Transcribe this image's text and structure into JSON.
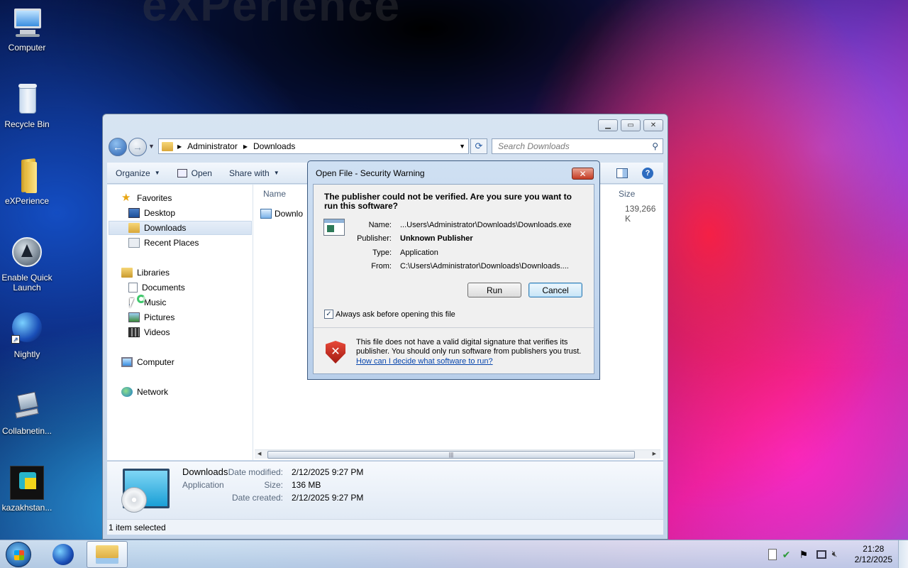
{
  "desktop": {
    "watermark": "eXPerience",
    "icons": [
      {
        "label": "Computer",
        "icon": "computer-icon"
      },
      {
        "label": "Recycle Bin",
        "icon": "recycle-bin-icon"
      },
      {
        "label": "eXPerience",
        "icon": "folder-icon"
      },
      {
        "label": "Enable Quick Launch",
        "icon": "quick-launch-icon"
      },
      {
        "label": "Nightly",
        "icon": "nightly-browser-icon"
      },
      {
        "label": "Collabnetin...",
        "icon": "network-computer-icon"
      },
      {
        "label": "kazakhstan...",
        "icon": "app-icon"
      }
    ]
  },
  "explorer": {
    "breadcrumb": [
      "Administrator",
      "Downloads"
    ],
    "search_placeholder": "Search Downloads",
    "toolbar": {
      "organize": "Organize",
      "open": "Open",
      "share_with": "Share with"
    },
    "nav": {
      "favorites": "Favorites",
      "desktop": "Desktop",
      "downloads": "Downloads",
      "recent": "Recent Places",
      "libraries": "Libraries",
      "documents": "Documents",
      "music": "Music",
      "pictures": "Pictures",
      "videos": "Videos",
      "computer": "Computer",
      "network": "Network"
    },
    "columns": {
      "name": "Name",
      "size": "Size"
    },
    "file": {
      "name": "Downlo",
      "size": "139,266 K"
    },
    "details": {
      "name": "Downloads",
      "type": "Application",
      "date_modified_label": "Date modified:",
      "date_modified": "2/12/2025 9:27 PM",
      "size_label": "Size:",
      "size": "136 MB",
      "date_created_label": "Date created:",
      "date_created": "2/12/2025 9:27 PM"
    },
    "status": "1 item selected"
  },
  "dialog": {
    "title": "Open File - Security Warning",
    "question": "The publisher could not be verified.  Are you sure you want to run this software?",
    "name_label": "Name:",
    "name": "...Users\\Administrator\\Downloads\\Downloads.exe",
    "publisher_label": "Publisher:",
    "publisher": "Unknown Publisher",
    "type_label": "Type:",
    "type": "Application",
    "from_label": "From:",
    "from": "C:\\Users\\Administrator\\Downloads\\Downloads....",
    "run": "Run",
    "cancel": "Cancel",
    "checkbox": "Always ask before opening this file",
    "checkbox_checked": true,
    "warning": "This file does not have a valid digital signature that verifies its publisher.  You should only run software from publishers you trust.",
    "help_link": "How can I decide what software to run?"
  },
  "taskbar": {
    "time": "21:28",
    "date": "2/12/2025"
  }
}
